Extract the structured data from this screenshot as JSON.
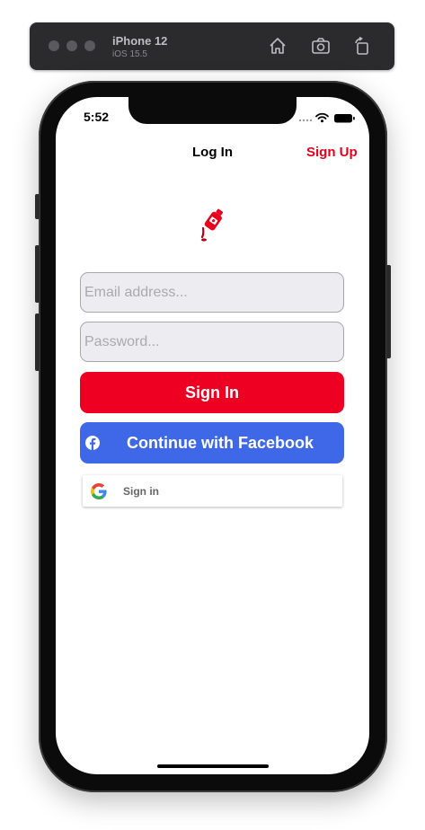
{
  "simulator": {
    "device_name": "iPhone 12",
    "os_version": "iOS 15.5",
    "icons": [
      "home-icon",
      "screenshot-icon",
      "rotate-icon"
    ]
  },
  "status_bar": {
    "time": "5:52",
    "icons": [
      "signal-icon",
      "wifi-icon",
      "battery-icon"
    ]
  },
  "nav": {
    "title": "Log In",
    "action_label": "Sign Up"
  },
  "form": {
    "email_placeholder": "Email address...",
    "email_value": "",
    "password_placeholder": "Password...",
    "password_value": ""
  },
  "buttons": {
    "sign_in_label": "Sign In",
    "facebook_label": "Continue with Facebook",
    "google_label": "Sign in"
  },
  "colors": {
    "brand_red": "#ee0022",
    "facebook_blue": "#3f68e8",
    "field_background": "#ececf1"
  }
}
